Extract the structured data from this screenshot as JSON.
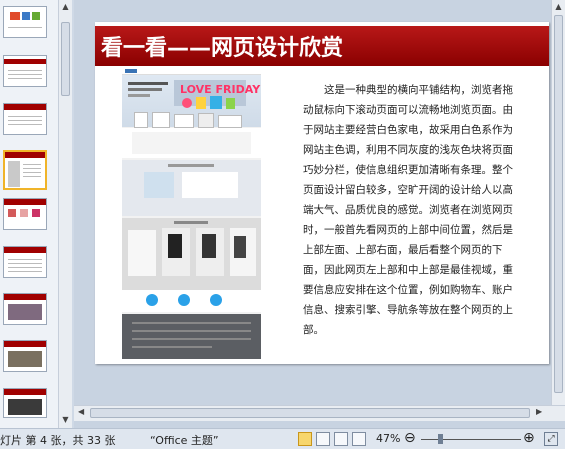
{
  "slide": {
    "title": "看一看——网页设计欣赏",
    "body": "这是一种典型的横向平铺结构，浏览者拖动鼠标向下滚动页面可以流畅地浏览页面。由于网站主要经营白色家电，故采用白色系作为网站主色调，利用不同灰度的浅灰色块将页面巧妙分栏，使信息组织更加清晰有条理。整个页面设计留白较多，空旷开阔的设计给人以高端大气、品质优良的感觉。浏览者在浏览网页时，一般首先看网页的上部中间位置，然后是上部左面、上部右面，最后看整个网页的下面，因此网页左上部和中上部是最佳视域，重要信息应安排在这个位置，例如购物车、账户信息、搜索引擎、导航条等放在整个网页的上部。",
    "screenshot_banner": "LOVE FRIDAY"
  },
  "status": {
    "slide_info": "灯片 第 4 张，共 33 张",
    "theme": "“Office 主题”",
    "zoom": "47%"
  },
  "colors": {
    "title_bar": "#a00000",
    "selected_thumb": "#f0b429"
  },
  "icons": [
    "normal-view-icon",
    "slide-sorter-icon",
    "reading-view-icon",
    "slideshow-icon",
    "zoom-out-icon",
    "zoom-in-icon",
    "fit-window-icon"
  ]
}
